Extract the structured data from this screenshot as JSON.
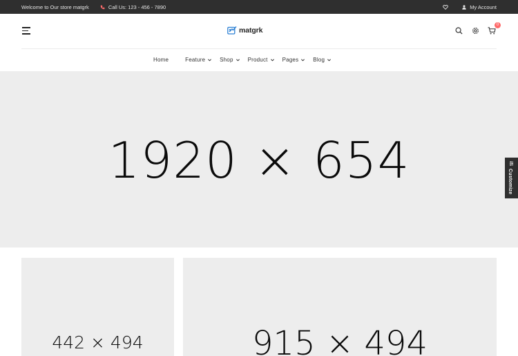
{
  "topbar": {
    "welcome": "Welcome to Our store matgrk",
    "phone": "Call Us: 123 - 456 - 7890",
    "account": "My Account"
  },
  "header": {
    "logo_text": "matgrk",
    "cart_count": "0"
  },
  "nav": {
    "items": [
      {
        "label": "Home"
      },
      {
        "label": "Feature"
      },
      {
        "label": "Shop"
      },
      {
        "label": "Product"
      },
      {
        "label": "Pages"
      },
      {
        "label": "Blog"
      }
    ]
  },
  "hero": {
    "placeholder": "1920 × 654"
  },
  "customize": {
    "label": "Customize"
  },
  "banners": {
    "left_placeholder": "442 × 494",
    "right_placeholder": "915 × 494"
  },
  "colors": {
    "topbar_bg": "#2f2f2f",
    "placeholder_bg": "#ededed",
    "accent": "#ff6b6b",
    "logo_blue": "#2a7fd4"
  },
  "icons": [
    "phone-icon",
    "heart-icon",
    "user-icon",
    "menu-icon",
    "search-icon",
    "gear-icon",
    "cart-icon",
    "chevron-down-icon",
    "sliders-icon"
  ]
}
